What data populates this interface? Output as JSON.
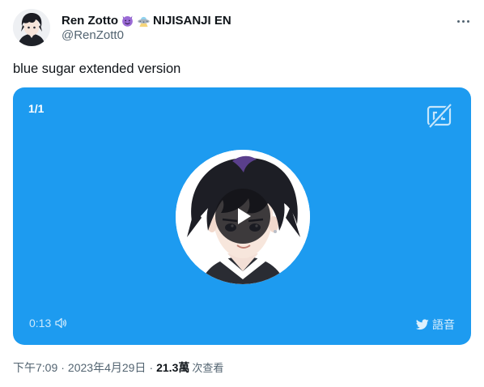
{
  "author": {
    "display_name": "Ren Zotto",
    "emoji_icons": [
      "smiling-devil-icon",
      "flying-saucer-icon"
    ],
    "affiliation": "NIJISANJI EN",
    "handle": "@RenZott0"
  },
  "tweet": {
    "text": "blue sugar extended version"
  },
  "media": {
    "count": "1/1",
    "background_color": "#1d9bf0",
    "time": "0:13",
    "audio_label": "語音",
    "icons": [
      "closed-captions-off-icon",
      "play-icon",
      "speaker-icon",
      "bird-icon"
    ]
  },
  "meta": {
    "time": "下午7:09",
    "date": "2023年4月29日",
    "views_count": "21.3萬",
    "views_label": "次查看",
    "separator": "·"
  },
  "colors": {
    "text_primary": "#0f1419",
    "text_secondary": "#536471",
    "accent": "#1d9bf0"
  }
}
